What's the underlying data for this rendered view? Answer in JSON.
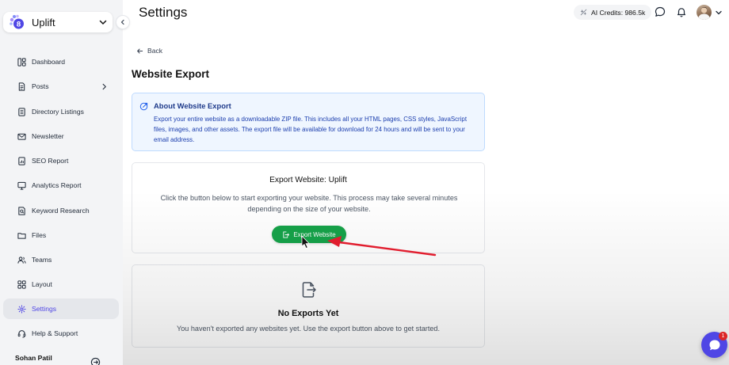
{
  "workspace": {
    "name": "Uplift",
    "logo_badge": "8"
  },
  "sidebar": {
    "items": [
      {
        "label": "Dashboard",
        "icon": "dashboard-icon"
      },
      {
        "label": "Posts",
        "icon": "document-icon",
        "has_submenu": true
      },
      {
        "label": "Directory Listings",
        "icon": "listing-icon"
      },
      {
        "label": "Newsletter",
        "icon": "mail-icon"
      },
      {
        "label": "SEO Report",
        "icon": "report-icon"
      },
      {
        "label": "Analytics Report",
        "icon": "monitor-icon"
      },
      {
        "label": "Keyword Research",
        "icon": "search-document-icon"
      },
      {
        "label": "Files",
        "icon": "folder-icon"
      },
      {
        "label": "Teams",
        "icon": "users-icon"
      },
      {
        "label": "Layout",
        "icon": "grid-icon"
      },
      {
        "label": "Settings",
        "icon": "gear-icon",
        "active": true
      },
      {
        "label": "Help & Support",
        "icon": "headset-icon"
      }
    ],
    "user_name": "Sohan Patil"
  },
  "header": {
    "title": "Settings",
    "credits_label": "AI Credits: 986.5k"
  },
  "main": {
    "back_label": "Back",
    "section_title": "Website Export",
    "info": {
      "title": "About Website Export",
      "text": "Export your entire website as a downloadable ZIP file. This includes all your HTML pages, CSS styles, JavaScript files, images, and other assets. The export file will be available for download for 24 hours and will be sent to your email address."
    },
    "export_card": {
      "title": "Export Website: Uplift",
      "description": "Click the button below to start exporting your website. This process may take several minutes depending on the size of your website.",
      "button_label": "Export Website"
    },
    "empty_state": {
      "title": "No Exports Yet",
      "description": "You haven't exported any websites yet. Use the export button above to get started."
    }
  },
  "chat": {
    "badge_count": "1"
  },
  "colors": {
    "accent": "#4f46e5",
    "export_button": "#16a34a",
    "info_bg": "#eff6ff",
    "annotation_arrow": "#e11d2e"
  }
}
